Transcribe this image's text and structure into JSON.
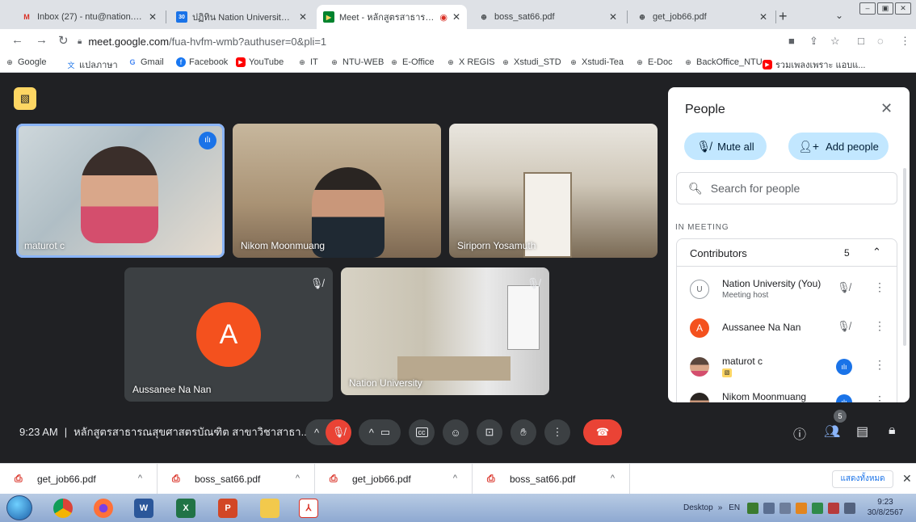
{
  "browser": {
    "tabs": [
      {
        "title": "Inbox (27) - ntu@nation.ac.th -",
        "favicon": "gmail-icon"
      },
      {
        "title": "ปฏิทิน Nation University - วันศุ",
        "favicon": "calendar-icon"
      },
      {
        "title": "Meet - หลักสูตรสาธารณสุข",
        "favicon": "meet-icon",
        "active": true
      },
      {
        "title": "boss_sat66.pdf",
        "favicon": "globe-icon"
      },
      {
        "title": "get_job66.pdf",
        "favicon": "globe-icon"
      }
    ],
    "new_tab": "+",
    "url_host": "meet.google.com",
    "url_path": "/fua-hvfm-wmb?authuser=0&pli=1",
    "bookmarks": [
      {
        "label": "Google",
        "icon": "globe-icon"
      },
      {
        "label": "แปลภาษา",
        "icon": "translate-icon"
      },
      {
        "label": "Gmail",
        "icon": "google-icon"
      },
      {
        "label": "Facebook",
        "icon": "facebook-icon"
      },
      {
        "label": "YouTube",
        "icon": "youtube-icon"
      },
      {
        "label": "IT",
        "icon": "globe-icon"
      },
      {
        "label": "NTU-WEB",
        "icon": "globe-icon"
      },
      {
        "label": "E-Office",
        "icon": "globe-icon"
      },
      {
        "label": "X REGIS",
        "icon": "globe-icon"
      },
      {
        "label": "Xstudi_STD",
        "icon": "globe-icon"
      },
      {
        "label": "Xstudi-Tea",
        "icon": "globe-icon"
      },
      {
        "label": "E-Doc",
        "icon": "globe-icon"
      },
      {
        "label": "BackOffice_NTU",
        "icon": "globe-icon"
      },
      {
        "label": "รวมเพลงเพราะ แอบแ...",
        "icon": "youtube-icon"
      }
    ]
  },
  "meet": {
    "tiles": [
      {
        "name": "maturot c",
        "state": "speaking"
      },
      {
        "name": "Nikom Moonmuang",
        "state": "none"
      },
      {
        "name": "Siriporn Yosamuth",
        "state": "none"
      },
      {
        "name": "Aussanee Na Nan",
        "state": "muted",
        "initial": "A"
      },
      {
        "name": "Nation University",
        "state": "muted"
      }
    ],
    "time": "9:23 AM",
    "separator": "|",
    "meeting_title": "หลักสูตรสาธารณสุขศาสตรบัณฑิต สาขาวิชาสาธา...",
    "participant_count": "5"
  },
  "people": {
    "title": "People",
    "mute_all": "Mute all",
    "add_people": "Add people",
    "search_placeholder": "Search for people",
    "in_meeting": "IN MEETING",
    "contributors_label": "Contributors",
    "contributors_count": "5",
    "participants": [
      {
        "name": "Nation University (You)",
        "role": "Meeting host",
        "mic": "muted"
      },
      {
        "name": "Aussanee Na Nan",
        "role": "",
        "mic": "muted",
        "initial": "A"
      },
      {
        "name": "maturot c",
        "role": "",
        "mic": "speaking"
      },
      {
        "name": "Nikom Moonmuang",
        "role": "",
        "mic": "speaking"
      }
    ]
  },
  "downloads": {
    "items": [
      "get_job66.pdf",
      "boss_sat66.pdf",
      "get_job66.pdf",
      "boss_sat66.pdf"
    ],
    "show_all": "แสดงทั้งหมด"
  },
  "taskbar": {
    "desktop": "Desktop",
    "lang": "EN",
    "clock_time": "9:23",
    "clock_date": "30/8/2567"
  },
  "colors": {
    "meet_bg": "#202124",
    "accent_blue": "#1a73e8",
    "end_call_red": "#ea4335",
    "avatar_orange": "#f4511e",
    "pill_blue": "#c2e7ff"
  }
}
